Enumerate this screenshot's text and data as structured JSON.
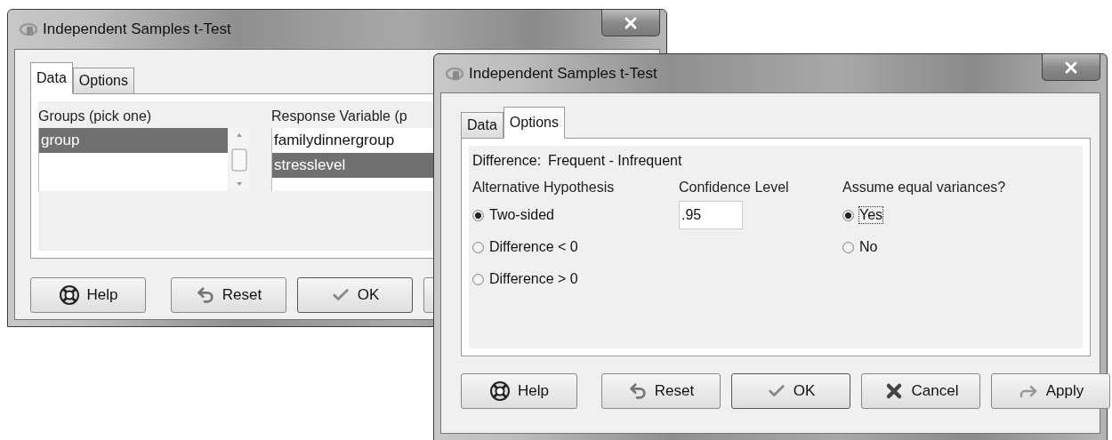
{
  "data_dialog": {
    "title": "Independent Samples t-Test",
    "tabs": [
      {
        "label": "Data",
        "selected": true
      },
      {
        "label": "Options",
        "selected": false
      }
    ],
    "groups": {
      "label": "Groups (pick one)",
      "items": [
        {
          "label": "group",
          "selected": true
        }
      ]
    },
    "response": {
      "label": "Response Variable (p",
      "items": [
        {
          "label": "familydinnergroup",
          "selected": false
        },
        {
          "label": "stresslevel",
          "selected": true
        }
      ]
    },
    "buttons": [
      {
        "kind": "help",
        "label": "Help"
      },
      {
        "kind": "reset",
        "label": "Reset"
      },
      {
        "kind": "ok",
        "label": "OK"
      },
      {
        "kind": "hidden"
      }
    ]
  },
  "options_dialog": {
    "title": "Independent Samples t-Test",
    "tabs": [
      {
        "label": "Data",
        "selected": false
      },
      {
        "label": "Options",
        "selected": true
      }
    ],
    "difference": {
      "label": "Difference:",
      "value": "Frequent - Infrequent"
    },
    "alternative": {
      "label": "Alternative Hypothesis",
      "options": [
        {
          "label": "Two-sided",
          "selected": true
        },
        {
          "label": "Difference < 0",
          "selected": false
        },
        {
          "label": "Difference > 0",
          "selected": false
        }
      ]
    },
    "confidence": {
      "label": "Confidence Level",
      "value": ".95"
    },
    "equal_variances": {
      "label": "Assume equal variances?",
      "options": [
        {
          "label": "Yes",
          "selected": true,
          "focused": true
        },
        {
          "label": "No",
          "selected": false,
          "focused": false
        }
      ]
    },
    "buttons": [
      {
        "kind": "help",
        "label": "Help"
      },
      {
        "kind": "reset",
        "label": "Reset"
      },
      {
        "kind": "ok",
        "label": "OK"
      },
      {
        "kind": "cancel",
        "label": "Cancel"
      },
      {
        "kind": "apply",
        "label": "Apply"
      }
    ]
  }
}
